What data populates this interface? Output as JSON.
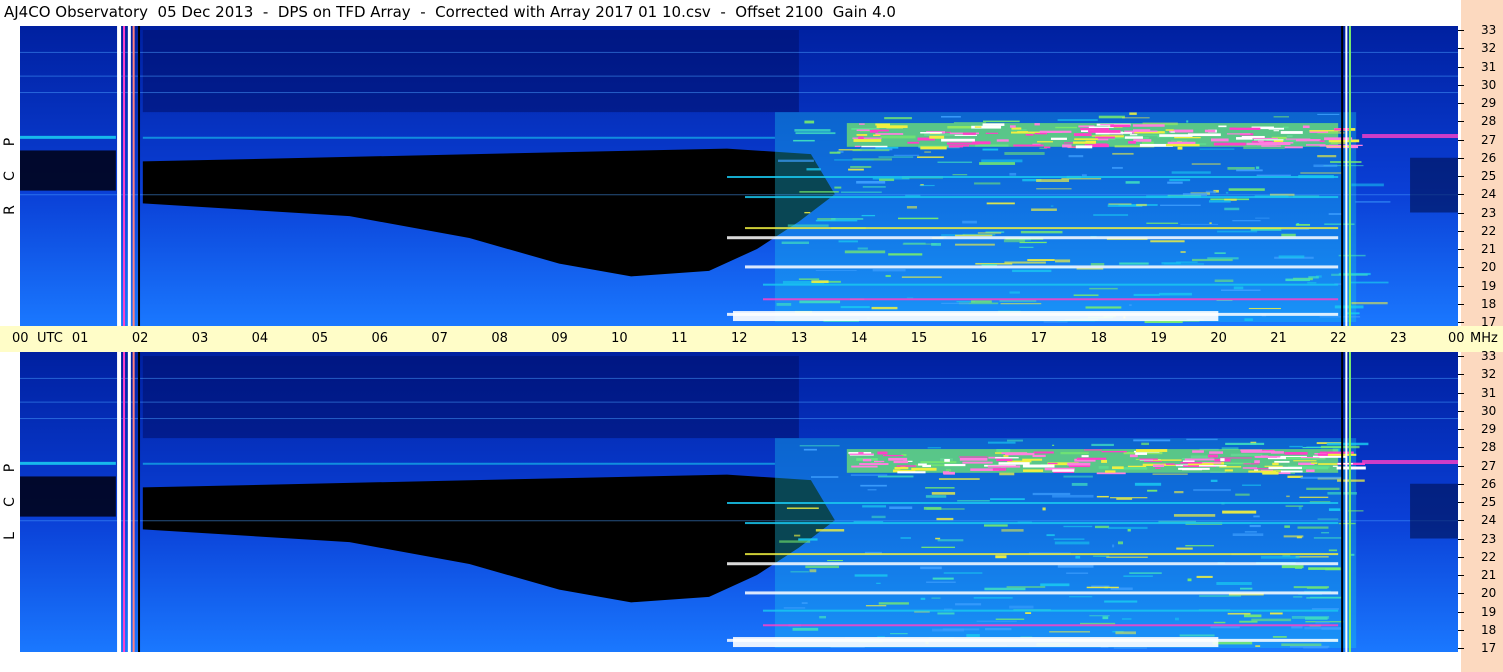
{
  "header": {
    "title": "AJ4CO Observatory  05 Dec 2013  -  DPS on TFD Array  -  Corrected with Array 2017 01 10.csv  -  Offset 2100  Gain 4.0"
  },
  "panels": [
    {
      "id": "rcp",
      "label_letters": [
        "P",
        "C",
        "R"
      ]
    },
    {
      "id": "lcp",
      "label_letters": [
        "P",
        "C",
        "L"
      ]
    }
  ],
  "colors": {
    "background_blue": "#0a3fd6",
    "deep_blue": "#0020a0",
    "black": "#000000",
    "cyan": "#19c8f0",
    "green": "#7af06a",
    "yellow": "#f0f040",
    "magenta": "#ff40c8",
    "white": "#ffffff",
    "axis_bg": "#fffdc8",
    "right_strip": "#fcd9bf"
  },
  "chart_data": {
    "type": "heatmap",
    "title": "AJ4CO Observatory  05 Dec 2013  -  DPS on TFD Array  -  Corrected with Array 2017 01 10.csv  -  Offset 2100  Gain 4.0",
    "x_axis": {
      "unit_label": "UTC",
      "range": [
        0,
        24
      ],
      "tick_labels": [
        "00",
        "01",
        "02",
        "03",
        "04",
        "05",
        "06",
        "07",
        "08",
        "09",
        "10",
        "11",
        "12",
        "13",
        "14",
        "15",
        "16",
        "17",
        "18",
        "19",
        "20",
        "21",
        "22",
        "23",
        "00"
      ],
      "end_unit": "MHz"
    },
    "y_axis": {
      "unit": "MHz",
      "range": [
        17,
        33
      ],
      "tick_labels": [
        "33",
        "32",
        "31",
        "30",
        "29",
        "28",
        "27",
        "26",
        "25",
        "24",
        "23",
        "22",
        "21",
        "20",
        "19",
        "18",
        "17"
      ]
    },
    "panels": [
      "R C P",
      "L C P"
    ]
  }
}
